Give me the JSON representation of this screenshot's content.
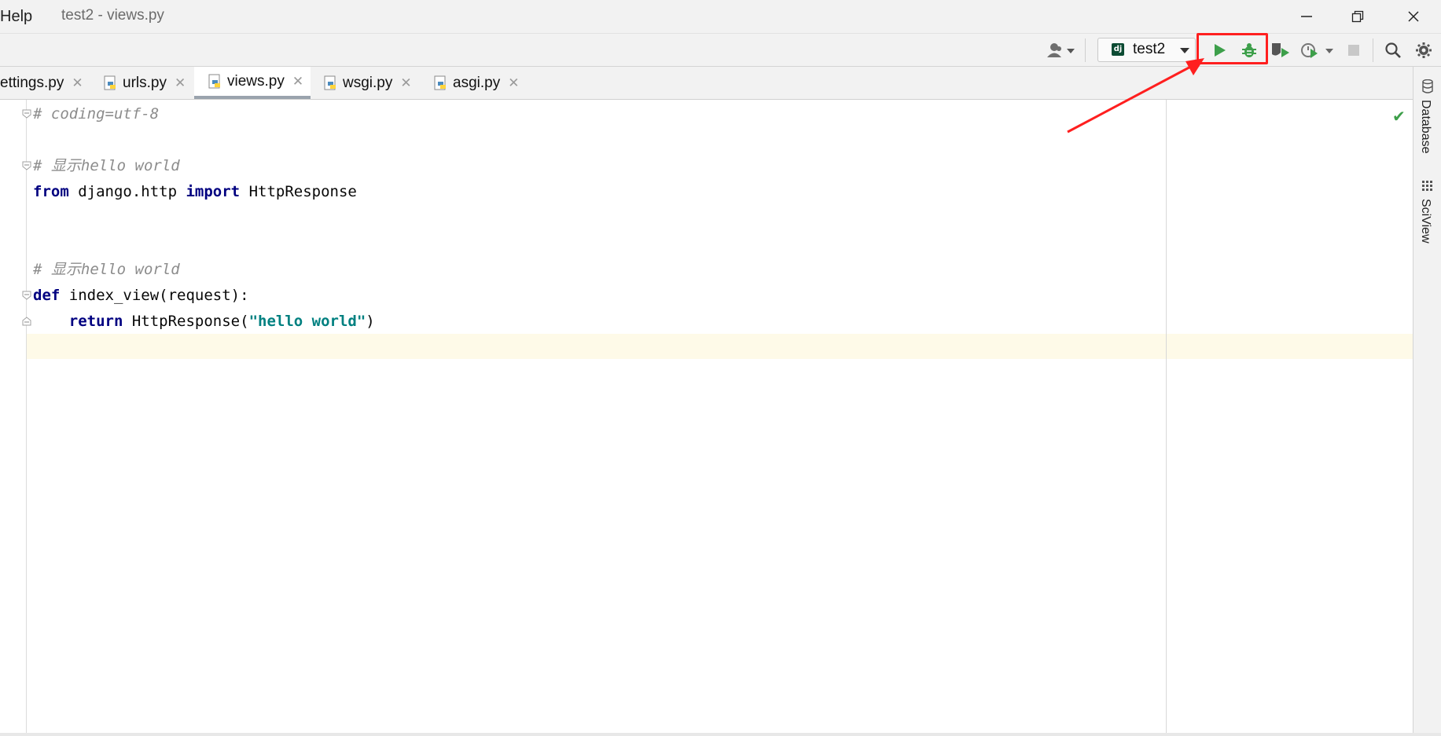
{
  "window": {
    "menu_help": "Help",
    "title": "test2 - views.py",
    "minimize_icon": "minimize-icon",
    "restore_icon": "restore-icon",
    "close_icon": "close-icon"
  },
  "toolbar": {
    "run_config_label": "test2",
    "icons": [
      "account-icon",
      "run-icon",
      "debug-icon",
      "coverage-icon",
      "profile-icon",
      "stop-icon",
      "search-icon",
      "settings-icon"
    ]
  },
  "tabs": [
    {
      "label": "ettings.py",
      "active": false
    },
    {
      "label": "urls.py",
      "active": false
    },
    {
      "label": "views.py",
      "active": true
    },
    {
      "label": "wsgi.py",
      "active": false
    },
    {
      "label": "asgi.py",
      "active": false
    }
  ],
  "code": {
    "line1": "# coding=utf-8",
    "line3": "# 显示hello world",
    "line4_kw1": "from",
    "line4_mid": " django.http ",
    "line4_kw2": "import",
    "line4_end": " HttpResponse",
    "line7": "# 显示hello world",
    "line8_kw": "def",
    "line8_rest": " index_view(request):",
    "line9_indent": "    ",
    "line9_kw": "return",
    "line9_mid": " HttpResponse(",
    "line9_str": "\"hello world\"",
    "line9_end": ")"
  },
  "right_panel": {
    "tab1": "Database",
    "tab2": "SciView"
  },
  "colors": {
    "annotation_red": "#ff1f1f",
    "run_green": "#3d9f4a"
  }
}
